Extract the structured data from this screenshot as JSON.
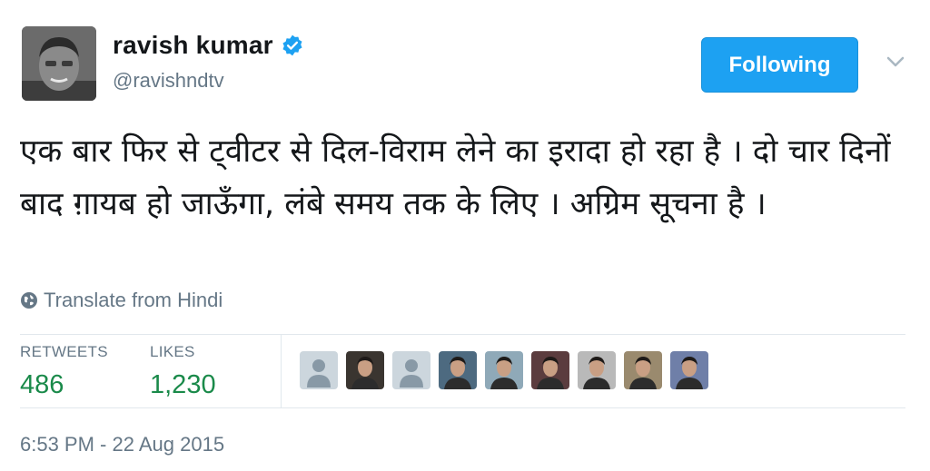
{
  "user": {
    "display_name": "ravish kumar",
    "handle": "@ravishndtv",
    "verified": true,
    "avatar_icon": "profile-photo"
  },
  "follow_button": {
    "label": "Following",
    "color": "#1da1f2"
  },
  "menu_icon": "chevron-down-icon",
  "tweet": {
    "text": "एक बार फिर से ट्वीटर से दिल-विराम लेने का इरादा हो रहा है । दो चार दिनों बाद ग़ायब हो जाऊँगा, लंबे समय तक के लिए । अग्रिम सूचना है ।"
  },
  "translate": {
    "icon": "globe-icon",
    "label": "Translate from Hindi"
  },
  "stats": {
    "retweets": {
      "label": "RETWEETS",
      "value": "486"
    },
    "likes": {
      "label": "LIKES",
      "value": "1,230"
    },
    "value_color": "#1a8a4a"
  },
  "likers": [
    {
      "type": "default-avatar",
      "bg": "#ccd6dd"
    },
    {
      "type": "photo",
      "bg": "#3a3530"
    },
    {
      "type": "default-avatar",
      "bg": "#ccd6dd"
    },
    {
      "type": "photo",
      "bg": "#4d6a80"
    },
    {
      "type": "photo",
      "bg": "#8fa9b8"
    },
    {
      "type": "photo",
      "bg": "#5b3c3e"
    },
    {
      "type": "photo",
      "bg": "#b9b9b9"
    },
    {
      "type": "photo",
      "bg": "#9a8a6e"
    },
    {
      "type": "photo",
      "bg": "#6f7fa8"
    }
  ],
  "timestamp": "6:53 PM - 22 Aug 2015"
}
